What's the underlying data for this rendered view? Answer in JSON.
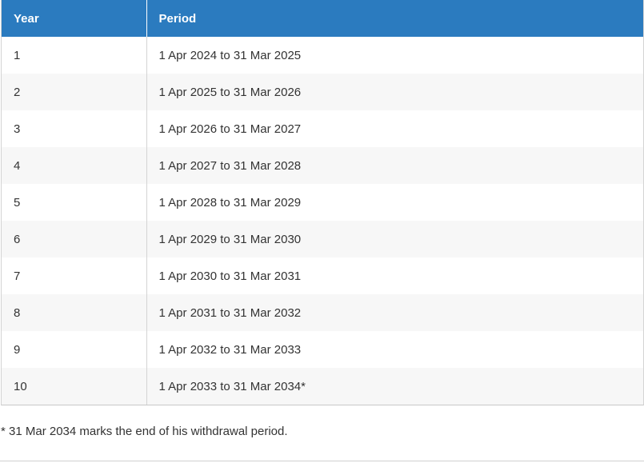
{
  "table": {
    "headers": {
      "year": "Year",
      "period": "Period"
    },
    "rows": [
      {
        "year": "1",
        "period": "1 Apr 2024 to 31 Mar 2025"
      },
      {
        "year": "2",
        "period": "1 Apr 2025 to 31 Mar 2026"
      },
      {
        "year": "3",
        "period": "1 Apr 2026 to 31 Mar 2027"
      },
      {
        "year": "4",
        "period": "1 Apr 2027 to 31 Mar 2028"
      },
      {
        "year": "5",
        "period": "1 Apr 2028 to 31 Mar 2029"
      },
      {
        "year": "6",
        "period": "1 Apr 2029 to 31 Mar 2030"
      },
      {
        "year": "7",
        "period": "1 Apr 2030 to 31 Mar 2031"
      },
      {
        "year": "8",
        "period": "1 Apr 2031 to 31 Mar 2032"
      },
      {
        "year": "9",
        "period": "1 Apr 2032 to 31 Mar 2033"
      },
      {
        "year": "10",
        "period": "1 Apr 2033 to 31 Mar 2034*"
      }
    ]
  },
  "footnote": "* 31 Mar 2034 marks the end of his withdrawal period.",
  "colors": {
    "header_bg": "#2b7bbf",
    "header_text": "#ffffff",
    "stripe": "#f7f7f7"
  }
}
